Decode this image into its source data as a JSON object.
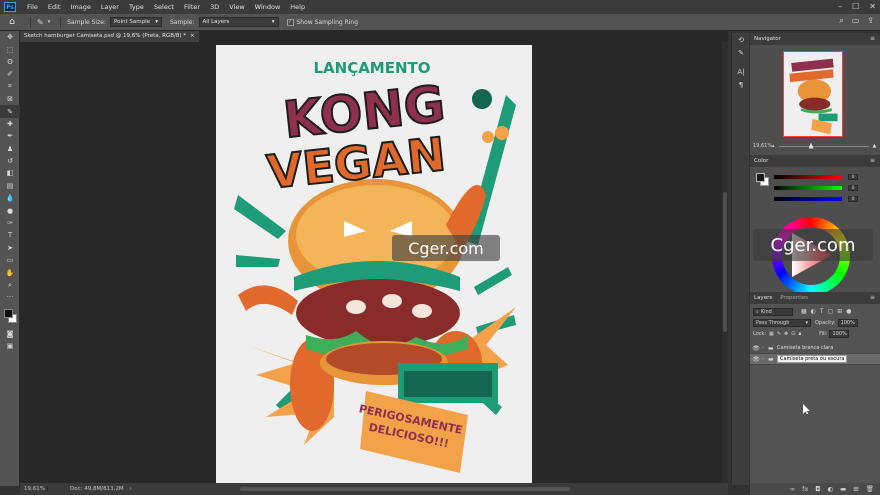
{
  "app": {
    "logo": "Ps"
  },
  "menu": [
    "File",
    "Edit",
    "Image",
    "Layer",
    "Type",
    "Select",
    "Filter",
    "3D",
    "View",
    "Window",
    "Help"
  ],
  "window_controls": [
    "–",
    "☐",
    "✕"
  ],
  "options": {
    "sample_size_label": "Sample Size:",
    "sample_size_value": "Point Sample",
    "sample_label": "Sample:",
    "sample_value": "All Layers",
    "show_ring_label": "Show Sampling Ring",
    "show_ring_checked": "✓"
  },
  "document": {
    "tab_title": "Sketch hamburger Camiseta.psd @ 19,6% (Preta, RGB/8) *",
    "tab_close": "×",
    "zoom": "19,61%",
    "doc_info": "Doc: 49,8M/813,2M"
  },
  "artwork": {
    "line1": "LANÇAMENTO",
    "line2": "KONG",
    "line3": "VEGAN",
    "banner1": "PERIGOSAMENTE",
    "banner2": "DELICIOSO!!!"
  },
  "watermark": {
    "center": "Cger.com",
    "right": "Cger.com"
  },
  "navigator": {
    "title": "Navigator",
    "zoom": "19,61%"
  },
  "color_panel": {
    "title": "Color",
    "slider_values": [
      "0",
      "0",
      "0"
    ]
  },
  "layers": {
    "tab_layers": "Layers",
    "tab_properties": "Properties",
    "kind": "Kind",
    "blend_mode": "Pass Through",
    "opacity_label": "Opacity:",
    "opacity_value": "100%",
    "lock_label": "Lock:",
    "fill_label": "Fill:",
    "fill_value": "100%",
    "items": [
      {
        "name": "Camiseta branca clara"
      },
      {
        "name": "Camiseta preta ou escura"
      }
    ]
  },
  "colors": {
    "accent": "#31a8ff",
    "panel": "#535353",
    "workspace": "#282828"
  }
}
